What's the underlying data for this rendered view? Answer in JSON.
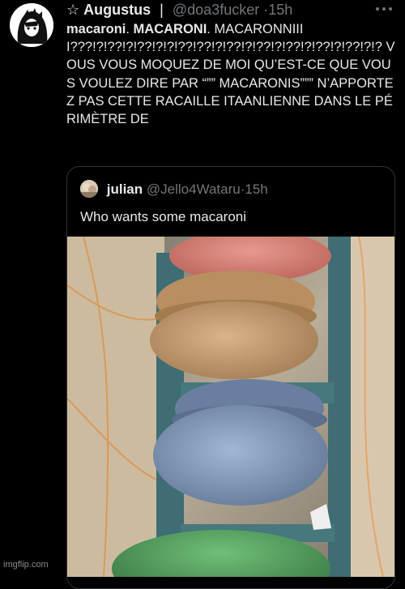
{
  "tweet": {
    "star": "☆",
    "author_name": "Augustus",
    "separator": "|",
    "handle": "@doa3fucker",
    "dot": "·",
    "time": "15h",
    "text_bold_1": "macaroni",
    "text_mid_1": ". ",
    "text_bold_2": "MACARONI",
    "text_body": ". MACARONNIIII???!?!??!?!??!?!?!??!??!?!??!?!??!?!??!?!??!?!??!?!? VOUS VOUS MOQUEZ DE MOI QU’EST-CE QUE VOUS VOULEZ DIRE PAR “”” MACARONIS””” N’APPORTEZ PAS CETTE RACAILLE ITAANLIENNE DANS LE PÉRIMÈTRE DE"
  },
  "quote": {
    "author_name": "julian",
    "handle": "@Jello4Wataru",
    "dot": "·",
    "time": "15h",
    "text": "Who wants some macaroni"
  },
  "icons": {
    "more": "more-horizontal-icon",
    "avatar": "avatar"
  },
  "colors": {
    "background": "#000000",
    "text": "#e7e9ea",
    "muted": "#71767b",
    "border": "#2f3336"
  },
  "watermark": "imgflip.com"
}
